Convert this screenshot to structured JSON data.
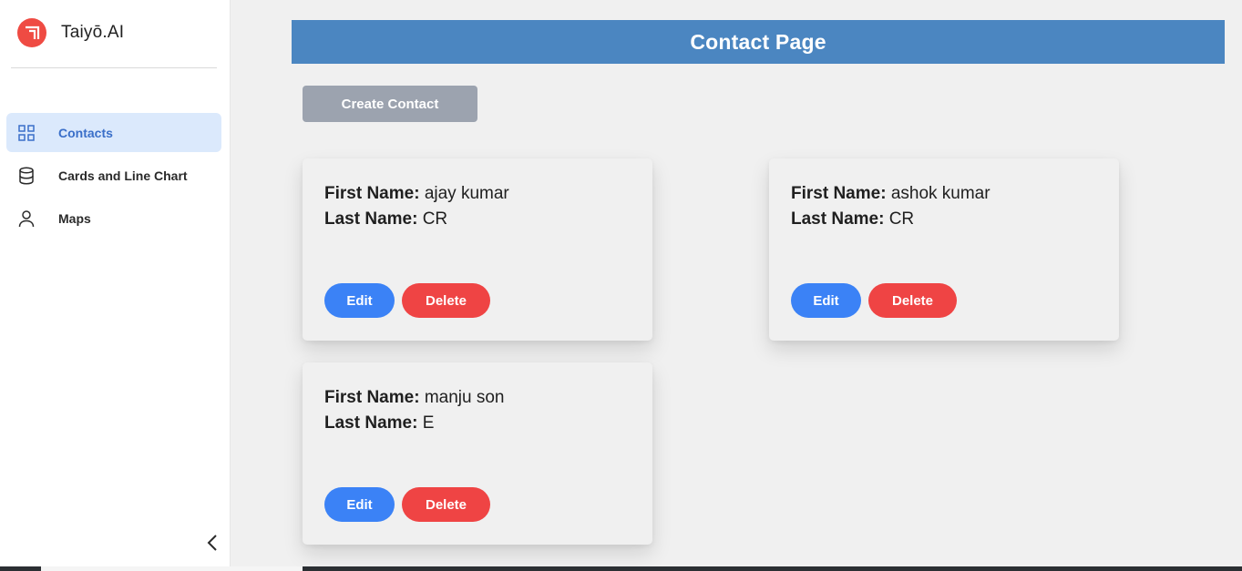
{
  "brand": {
    "name": "Taiyō.AI",
    "logo_color": "#ef4b43"
  },
  "sidebar": {
    "items": [
      {
        "label": "Contacts",
        "icon": "grid-icon",
        "active": true
      },
      {
        "label": "Cards and Line Chart",
        "icon": "database-icon",
        "active": false
      },
      {
        "label": "Maps",
        "icon": "user-icon",
        "active": false
      }
    ],
    "collapse_icon": "chevron-left-icon"
  },
  "header": {
    "title": "Contact Page",
    "color": "#4b86c1"
  },
  "actions": {
    "create_label": "Create Contact"
  },
  "contact_card": {
    "first_name_label": "First Name:",
    "last_name_label": "Last Name:",
    "edit_label": "Edit",
    "delete_label": "Delete"
  },
  "contacts": [
    {
      "first_name": "ajay kumar",
      "last_name": "CR"
    },
    {
      "first_name": "ashok kumar",
      "last_name": "CR"
    },
    {
      "first_name": "manju son",
      "last_name": "E"
    }
  ],
  "colors": {
    "edit": "#3b82f6",
    "delete": "#ef4444",
    "create_disabled": "#9ca3af",
    "active_nav": "#dbe9fc"
  }
}
